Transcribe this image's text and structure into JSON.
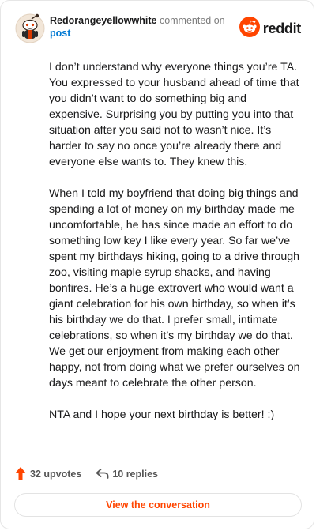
{
  "comment": {
    "author": "Redorangeyellowwhite",
    "action_text": "commented on",
    "target_link": "post",
    "avatar_icon": "snoo-avatar-icon",
    "brand": {
      "icon": "reddit-logo-icon",
      "wordmark": "reddit",
      "color": "#ff4500"
    },
    "paragraphs": [
      "I don’t understand why everyone things you’re TA. You expressed to your husband ahead of time that you didn’t want to do something big and expensive. Surprising you by putting you into that situation after you said not to wasn’t nice. It’s harder to say no once you’re already there and everyone else wants to. They knew this.",
      "When I told my boyfriend that doing big things and spending a lot of money on my birthday made me uncomfortable, he has since made an effort to do something low key I like every year. So far we’ve spent my birthdays hiking, going to a drive through zoo, visiting maple syrup shacks, and having bonfires. He’s a huge extrovert who would want a giant celebration for his own birthday, so when it’s his birthday we do that. I prefer small, intimate celebrations, so when it’s my birthday we do that. We get our enjoyment from making each other happy, not from doing what we prefer ourselves on days meant to celebrate the other person.",
      "NTA and I hope your next birthday is better! :)"
    ]
  },
  "footer": {
    "upvotes_label": "32 upvotes",
    "upvote_icon": "upvote-arrow-icon",
    "upvote_color": "#ff4500",
    "replies_label": "10 replies",
    "reply_icon": "reply-arrow-icon",
    "view_button_label": "View the conversation",
    "view_button_color": "#ff4500"
  }
}
